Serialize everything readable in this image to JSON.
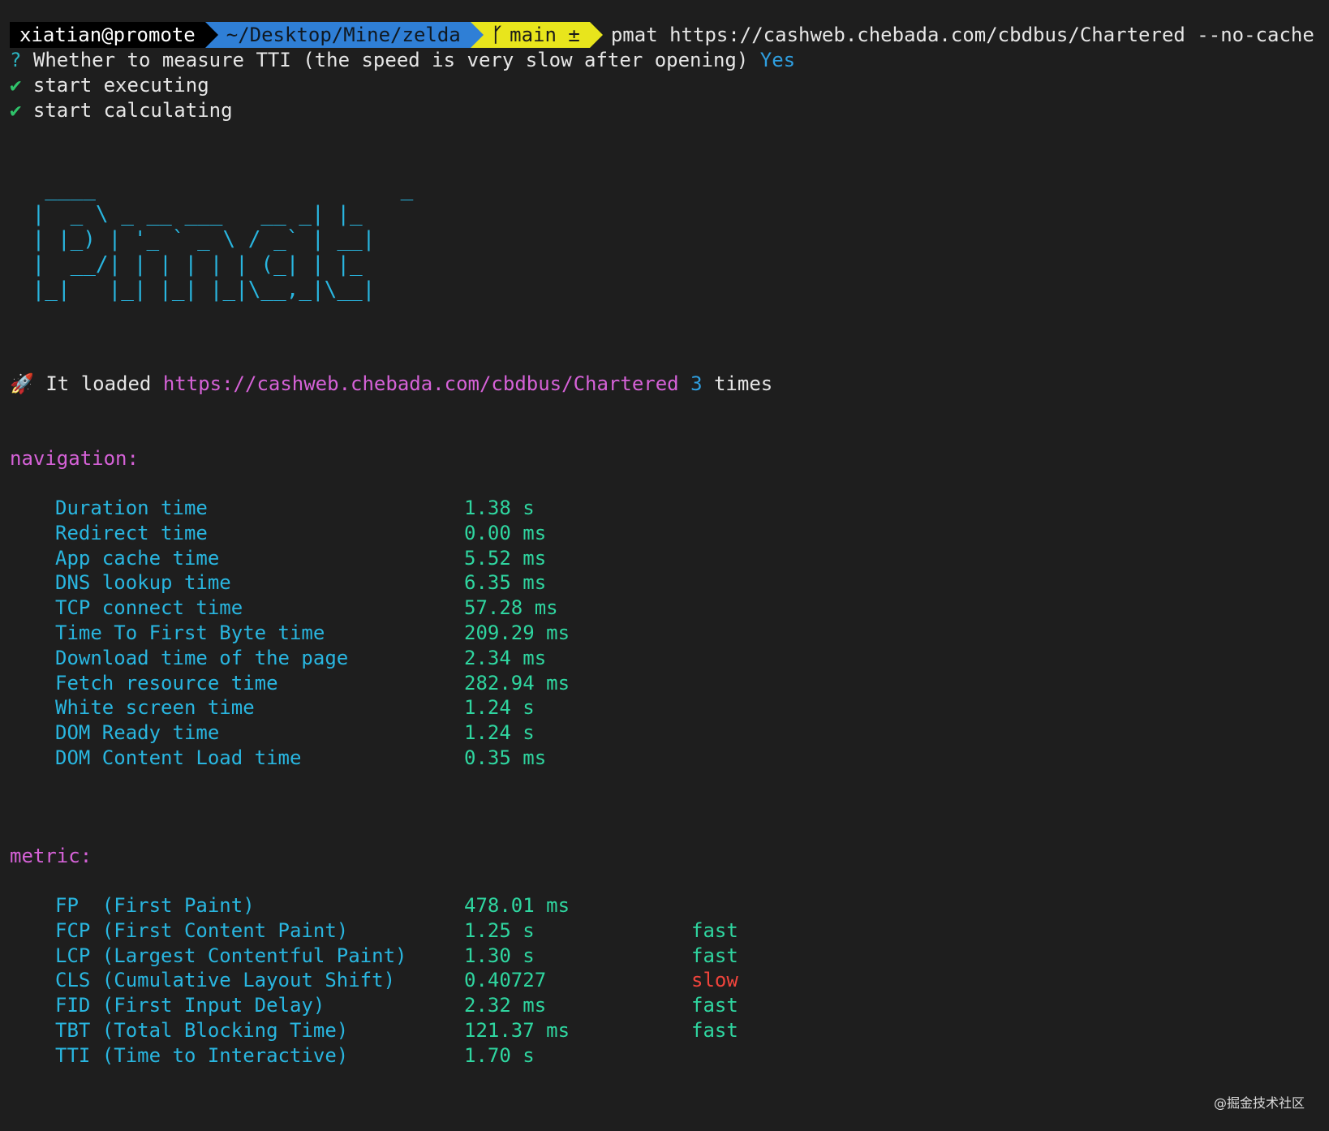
{
  "prompt": {
    "user": "xiatian@promote",
    "path": "~/Desktop/Mine/zelda",
    "branch_icon": "git-branch-icon",
    "branch": "main ±",
    "command": "pmat https://cashweb.chebada.com/cbdbus/Chartered --no-cache"
  },
  "question": {
    "mark": "?",
    "text": " Whether to measure TTI (the speed is very slow after opening) ",
    "answer": "Yes"
  },
  "steps": [
    {
      "icon": "✔",
      "text": " start executing"
    },
    {
      "icon": "✔",
      "text": " start calculating"
    }
  ],
  "ascii_logo": "  ____                        _   \n |  _ \\ _ __ ___   __ _| |_ \n | |_) | '_ ` _ \\ / _` | __|\n |  __/| | | | | | (_| | |_ \n |_|   |_| |_| |_|\\__,_|\\__|",
  "loaded": {
    "icon": "rocket-icon",
    "prefix": " It loaded ",
    "url": "https://cashweb.chebada.com/cbdbus/Chartered",
    "count": "3",
    "suffix": " times"
  },
  "navigation": {
    "title": "navigation:",
    "rows": [
      {
        "label": "Duration time",
        "value": "1.38 s"
      },
      {
        "label": "Redirect time",
        "value": "0.00 ms"
      },
      {
        "label": "App cache time",
        "value": "5.52 ms"
      },
      {
        "label": "DNS lookup time",
        "value": "6.35 ms"
      },
      {
        "label": "TCP connect time",
        "value": "57.28 ms"
      },
      {
        "label": "Time To First Byte time",
        "value": "209.29 ms"
      },
      {
        "label": "Download time of the page",
        "value": "2.34 ms"
      },
      {
        "label": "Fetch resource time",
        "value": "282.94 ms"
      },
      {
        "label": "White screen time",
        "value": "1.24 s"
      },
      {
        "label": "DOM Ready time",
        "value": "1.24 s"
      },
      {
        "label": "DOM Content Load time",
        "value": "0.35 ms"
      }
    ]
  },
  "metric": {
    "title": "metric:",
    "rows": [
      {
        "label": "FP  (First Paint)",
        "value": "478.01 ms",
        "rating": ""
      },
      {
        "label": "FCP (First Content Paint)",
        "value": "1.25 s",
        "rating": "fast"
      },
      {
        "label": "LCP (Largest Contentful Paint)",
        "value": "1.30 s",
        "rating": "fast"
      },
      {
        "label": "CLS (Cumulative Layout Shift)",
        "value": "0.40727",
        "rating": "slow"
      },
      {
        "label": "FID (First Input Delay)",
        "value": "2.32 ms",
        "rating": "fast"
      },
      {
        "label": "TBT (Total Blocking Time)",
        "value": "121.37 ms",
        "rating": "fast"
      },
      {
        "label": "TTI (Time to Interactive)",
        "value": "1.70 s",
        "rating": ""
      }
    ]
  },
  "watermark": "@掘金技术社区",
  "colors": {
    "background": "#1e1e1e",
    "label": "#29b6e0",
    "value": "#2fd6a0",
    "section": "#d662d8",
    "slow": "#f0443c",
    "path_segment": "#2f7fd6",
    "git_segment": "#e8e51c"
  }
}
